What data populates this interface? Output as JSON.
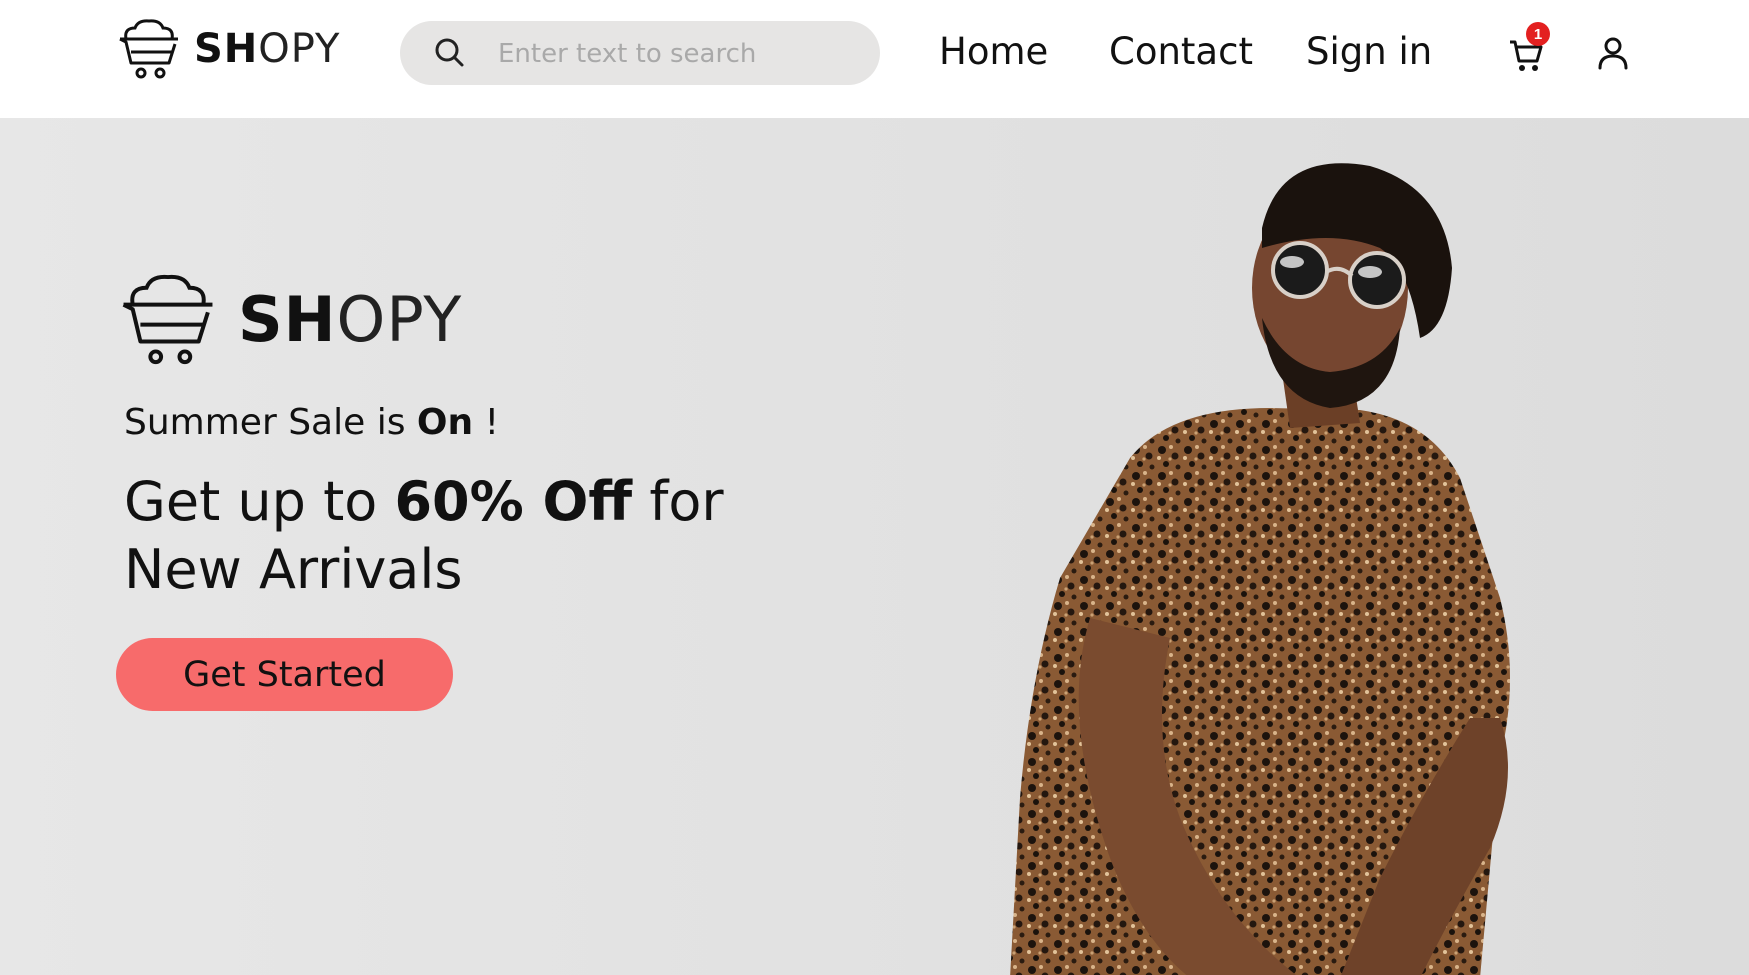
{
  "header": {
    "brand": {
      "bold": "SH",
      "light": "OPY",
      "icon": "cart-cloud-logo"
    },
    "search": {
      "placeholder": "Enter text to search",
      "value": "",
      "icon": "search-icon"
    },
    "nav": [
      {
        "label": "Home"
      },
      {
        "label": "Contact"
      },
      {
        "label": "Sign in"
      }
    ],
    "cart": {
      "icon": "cart-icon",
      "count": "1"
    },
    "user": {
      "icon": "user-icon"
    }
  },
  "hero": {
    "brand": {
      "bold": "SH",
      "light": "OPY"
    },
    "tagline": {
      "pre": "Summer Sale is ",
      "bold": "On",
      "post": " !"
    },
    "headline": {
      "pre": "Get up to ",
      "bold": "60% Off",
      "post": " for",
      "line2": "New Arrivals"
    },
    "cta_label": "Get Started",
    "image": "man-in-leopard-shirt-sunglasses"
  },
  "colors": {
    "accent": "#f76b6b",
    "badge": "#e32020",
    "search_bg": "#e6e5e4",
    "hero_bg": "#e4e4e4"
  }
}
